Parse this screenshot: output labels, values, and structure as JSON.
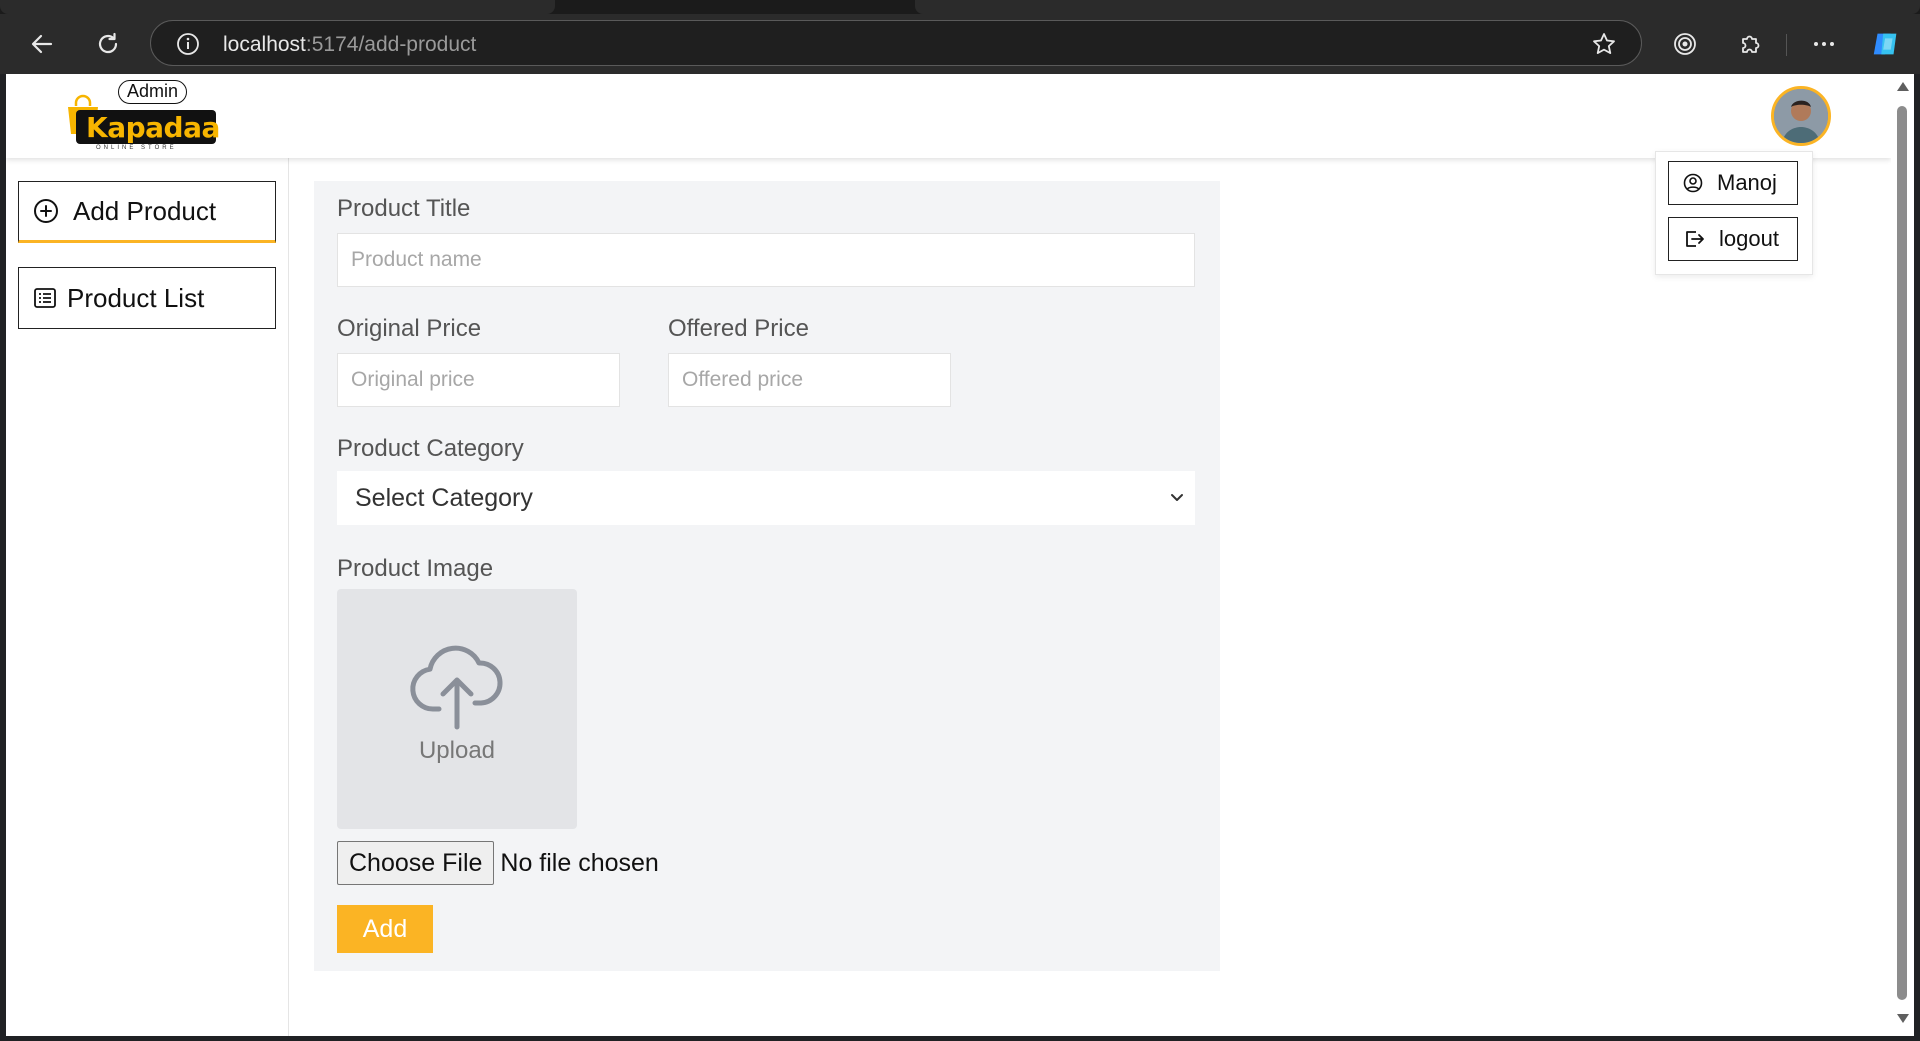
{
  "browser": {
    "url_host": "localhost",
    "url_path": ":5174/add-product"
  },
  "header": {
    "logo_badge": "Admin",
    "logo_text": "Kapadaa",
    "logo_subtext": "ONLINE STORE"
  },
  "user_menu": {
    "profile_label": "Manoj",
    "logout_label": "logout"
  },
  "sidebar": {
    "items": [
      {
        "label": "Add Product",
        "icon": "plus-circle-icon"
      },
      {
        "label": "Product List",
        "icon": "list-icon"
      }
    ]
  },
  "form": {
    "title_label": "Product Title",
    "title_placeholder": "Product name",
    "original_price_label": "Original Price",
    "original_price_placeholder": "Original price",
    "offered_price_label": "Offered Price",
    "offered_price_placeholder": "Offered price",
    "category_label": "Product Category",
    "category_selected": "Select Category",
    "image_label": "Product Image",
    "upload_label": "Upload",
    "choose_file_label": "Choose File",
    "no_file_text": "No file chosen",
    "submit_label": "Add"
  },
  "colors": {
    "accent": "#fbb424",
    "panel_bg": "#f3f4f6"
  }
}
